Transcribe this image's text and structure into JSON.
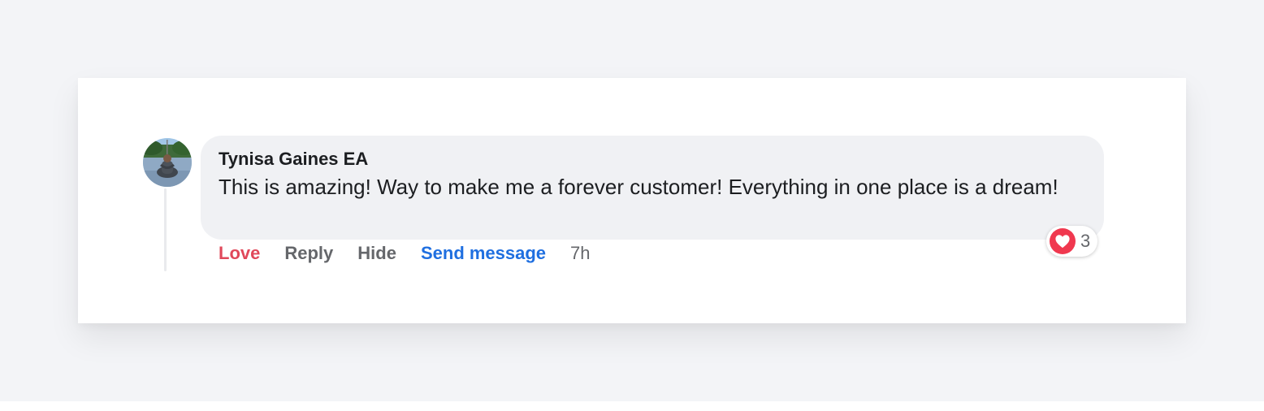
{
  "comment": {
    "author": "Tynisa Gaines EA",
    "text": "This is amazing! Way to make me a forever customer! Everything in one place is a dream!",
    "timestamp": "7h",
    "avatar_icon": "user-avatar-photo"
  },
  "actions": {
    "love": "Love",
    "reply": "Reply",
    "hide": "Hide",
    "send_message": "Send message"
  },
  "reactions": {
    "icon": "heart-icon",
    "count": "3"
  },
  "colors": {
    "love_red": "#e0485a",
    "link_blue": "#1f6fe0",
    "muted_gray": "#65676b",
    "bubble_gray": "#f0f1f4",
    "heart_red": "#f0384f"
  }
}
